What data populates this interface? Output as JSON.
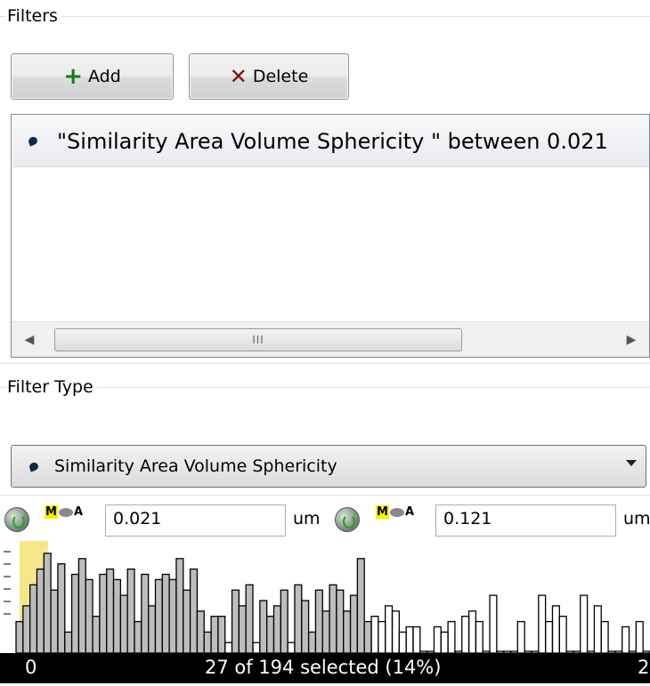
{
  "filters_group": {
    "title": "Filters"
  },
  "toolbar": {
    "add_label": "Add",
    "delete_label": "Delete"
  },
  "filter_list": {
    "items": [
      {
        "label": "\"Similarity Area Volume Sphericity \" between 0.021"
      }
    ],
    "scroll_grip": "III"
  },
  "filter_type_group": {
    "title": "Filter Type"
  },
  "filter_type_select": {
    "value": "Similarity Area Volume Sphericity"
  },
  "range": {
    "lower": {
      "value": "0.021",
      "unit": "um"
    },
    "upper": {
      "value": "0.121",
      "unit": "um"
    }
  },
  "histogram": {
    "min_label": "0",
    "max_label": "2",
    "status": "27 of 194 selected (14%)",
    "selected_fraction": 0.14,
    "bar_heights": [
      0.3,
      0.45,
      0.65,
      0.8,
      0.95,
      0.6,
      0.85,
      0.2,
      0.75,
      0.9,
      0.7,
      0.35,
      0.75,
      0.8,
      0.7,
      0.55,
      0.8,
      0.3,
      0.75,
      0.45,
      0.7,
      0.75,
      0.7,
      0.9,
      0.6,
      0.8,
      0.4,
      0.2,
      0.35,
      0.35,
      0.1,
      0.6,
      0.45,
      0.65,
      0.1,
      0.5,
      0.35,
      0.45,
      0.6,
      0.1,
      0.65,
      0.5,
      0.2,
      0.6,
      0.4,
      0.65,
      0.6,
      0.4,
      0.55,
      0.9,
      0.3,
      0.35,
      0.3,
      0.45,
      0.4,
      0.2,
      0.25,
      0.25,
      0.0,
      0.0,
      0.25,
      0.2,
      0.3,
      0.0,
      0.35,
      0.4,
      0.3,
      0.0,
      0.55,
      0.0,
      0.0,
      0.0,
      0.3,
      0.0,
      0.0,
      0.55,
      0.3,
      0.45,
      0.35,
      0.0,
      0.0,
      0.55,
      0.0,
      0.45,
      0.3,
      0.0,
      0.0,
      0.25,
      0.0,
      0.3,
      0.0
    ],
    "colors": {
      "selected_fill": "#f5e68a",
      "bar_fill": "#bdbdbd",
      "outline": "#000000"
    }
  }
}
